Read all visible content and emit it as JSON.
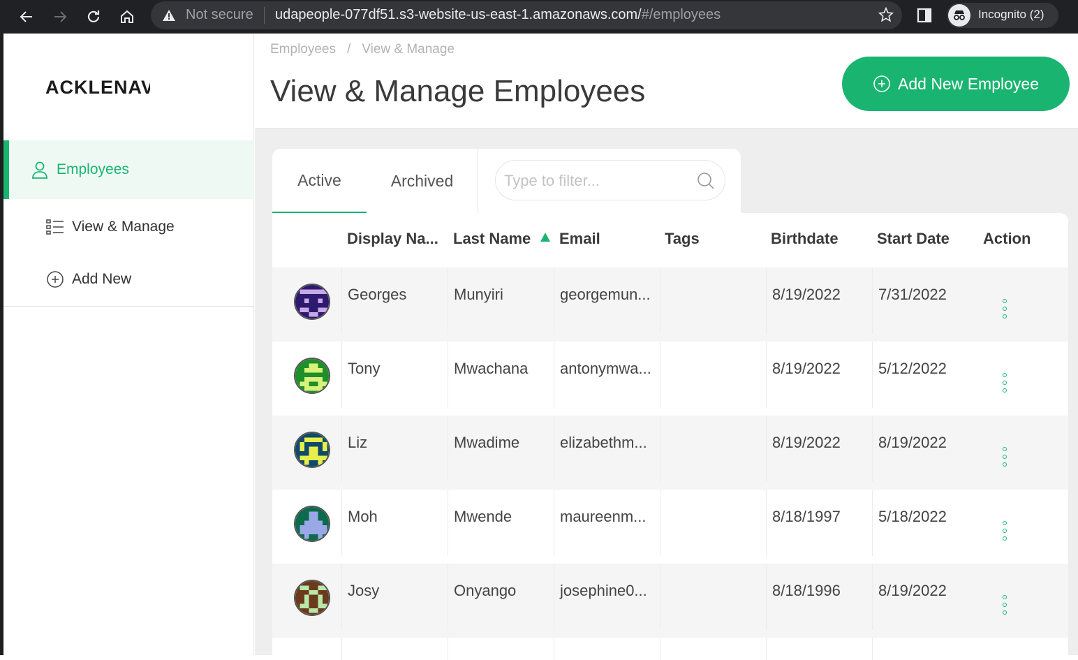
{
  "browser": {
    "security_label": "Not secure",
    "url_main": "udapeople-077df51.s3-website-us-east-1.amazonaws.com/",
    "url_dim": "#/employees",
    "incognito_label": "Incognito (2)"
  },
  "sidebar": {
    "logo_text": "ACKLENAVENUE",
    "items": [
      {
        "label": "Employees",
        "icon": "user-icon"
      },
      {
        "label": "View & Manage",
        "icon": "list-icon"
      },
      {
        "label": "Add New",
        "icon": "plus-circle-icon"
      }
    ]
  },
  "header": {
    "breadcrumb": [
      "Employees",
      "View & Manage"
    ],
    "title": "View & Manage Employees",
    "add_button_label": "Add New Employee"
  },
  "tabs": [
    {
      "label": "Active",
      "active": true
    },
    {
      "label": "Archived",
      "active": false
    }
  ],
  "filter": {
    "placeholder": "Type to filter...",
    "value": ""
  },
  "table": {
    "columns": [
      "Display Na...",
      "Last Name",
      "Email",
      "Tags",
      "Birthdate",
      "Start Date",
      "Action"
    ],
    "sorted_column": "Last Name",
    "sort_direction": "ascending",
    "rows": [
      {
        "display_name": "Georges",
        "last_name": "Munyiri",
        "email": "georgemun...",
        "tags": "",
        "birthdate": "8/19/2022",
        "start_date": "7/31/2022"
      },
      {
        "display_name": "Tony",
        "last_name": "Mwachana",
        "email": "antonymwa...",
        "tags": "",
        "birthdate": "8/19/2022",
        "start_date": "5/12/2022"
      },
      {
        "display_name": "Liz",
        "last_name": "Mwadime",
        "email": "elizabethm...",
        "tags": "",
        "birthdate": "8/19/2022",
        "start_date": "8/19/2022"
      },
      {
        "display_name": "Moh",
        "last_name": "Mwende",
        "email": "maureenm...",
        "tags": "",
        "birthdate": "8/18/1997",
        "start_date": "5/18/2022"
      },
      {
        "display_name": "Josy",
        "last_name": "Onyango",
        "email": "josephine0...",
        "tags": "",
        "birthdate": "8/18/1996",
        "start_date": "8/19/2022"
      }
    ]
  },
  "colors": {
    "accent": "#1ab471",
    "background": "#eeeeee",
    "browser": "#202124"
  }
}
